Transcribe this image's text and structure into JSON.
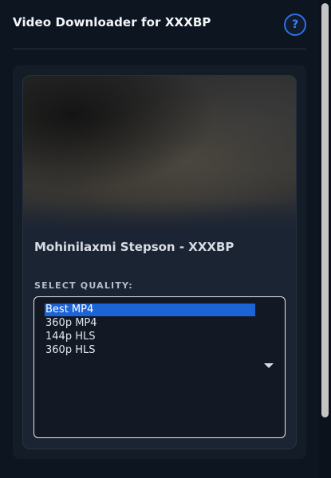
{
  "header": {
    "title": "Video Downloader for XXXBP",
    "help_label": "?"
  },
  "video": {
    "title": "Mohinilaxmi Stepson - XXXBP"
  },
  "quality": {
    "label": "SELECT QUALITY:",
    "options": [
      "Best MP4",
      "360p MP4",
      "144p HLS",
      "360p HLS"
    ],
    "selected": "Best MP4"
  },
  "colors": {
    "accent": "#2f6fe0",
    "selection": "#1c63d6",
    "background": "#0d1520",
    "card": "#1b2433"
  },
  "icons": {
    "help": "question-circle-icon",
    "dropdown": "chevron-down-icon"
  }
}
